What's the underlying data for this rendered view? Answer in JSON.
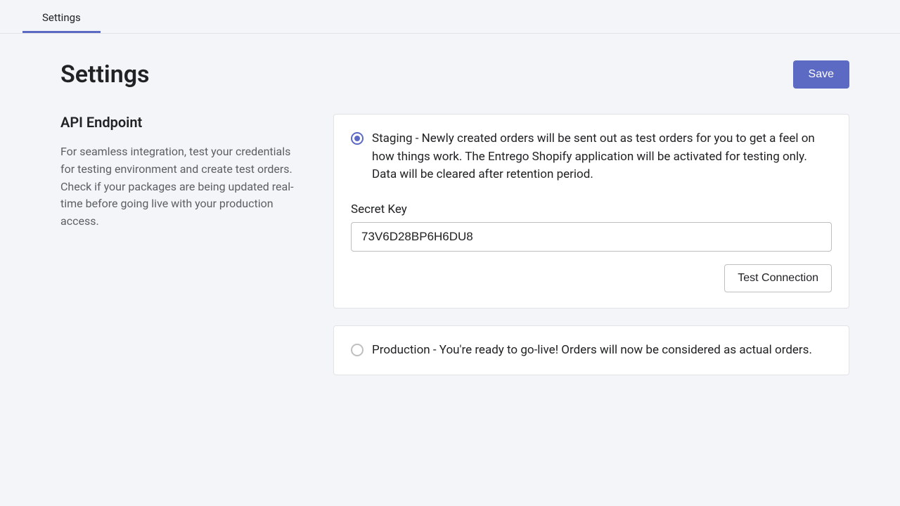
{
  "tabs": {
    "settings": "Settings"
  },
  "header": {
    "title": "Settings",
    "save_label": "Save"
  },
  "section": {
    "title": "API Endpoint",
    "description": "For seamless integration, test your credentials for testing environment and create test orders. Check if your packages are being updated real-time before going live with your production access."
  },
  "staging": {
    "label": "Staging - Newly created orders will be sent out as test orders for you to get a feel on how things work. The Entrego Shopify application will be activated for testing only. Data will be cleared after retention period.",
    "secret_key_label": "Secret Key",
    "secret_key_value": "73V6D28BP6H6DU8",
    "test_connection_label": "Test Connection"
  },
  "production": {
    "label": "Production - You're ready to go-live! Orders will now be considered as actual orders."
  }
}
